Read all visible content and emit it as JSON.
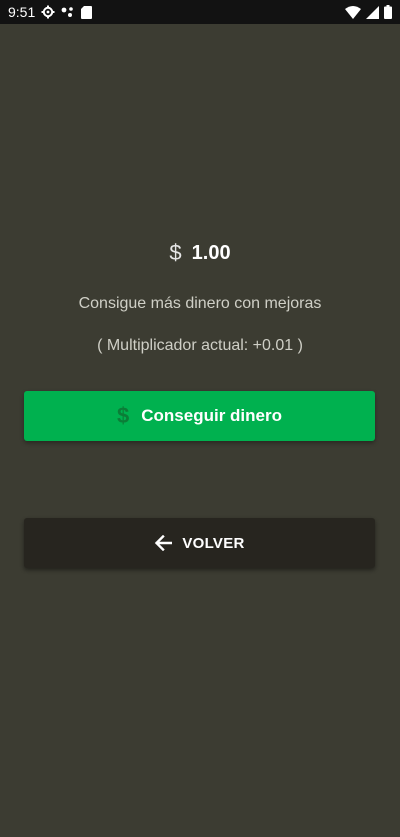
{
  "status_bar": {
    "time": "9:51",
    "left_icons": [
      "gear-icon",
      "app-notification-icon",
      "sd-card-icon"
    ],
    "right_icons": [
      "wifi-icon",
      "cell-signal-icon",
      "battery-icon"
    ]
  },
  "balance": {
    "currency_symbol": "$",
    "amount": "1.00"
  },
  "subtitle": "Consigue más dinero con mejoras",
  "multiplier_text": "( Multiplicador actual: +0.01 )",
  "earn_button": {
    "icon_symbol": "$",
    "label": "Conseguir dinero"
  },
  "back_button": {
    "icon": "arrow-left-icon",
    "label": "VOLVER"
  },
  "colors": {
    "background": "#3c3c32",
    "status_bar": "#121212",
    "earn_button": "#00b14f",
    "back_button": "#27251f"
  }
}
